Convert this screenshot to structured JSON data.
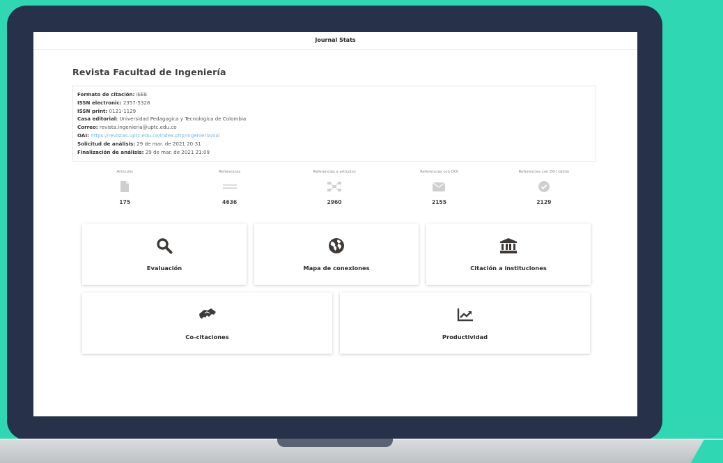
{
  "header": {
    "title": "Journal Stats"
  },
  "journal": {
    "title": "Revista Facultad de Ingeniería",
    "info": {
      "citation_format_label": "Formato de citación:",
      "citation_format": "IEEE",
      "issn_electronic_label": "ISSN electronic:",
      "issn_electronic": "2357-5328",
      "issn_print_label": "ISSN print:",
      "issn_print": "0121-1129",
      "publisher_label": "Casa editorial:",
      "publisher": "Universidad Pedagogica y Tecnologica de Colombia",
      "email_label": "Correo:",
      "email": "revista.ingenieria@uptc.edu.co",
      "oai_label": "OAI:",
      "oai": "https://revistas.uptc.edu.co/index.php/ingenieria/oai",
      "analysis_request_label": "Solicitud de análisis:",
      "analysis_request": "29 de mar. de 2021 20:31",
      "analysis_end_label": "Finalización de análisis:",
      "analysis_end": "29 de mar. de 2021 21:09"
    }
  },
  "stats": [
    {
      "label": "Articulos",
      "value": "175",
      "icon": "document-icon"
    },
    {
      "label": "Referencias",
      "value": "4636",
      "icon": "lines-icon"
    },
    {
      "label": "Referencias a articulos",
      "value": "2960",
      "icon": "network-icon"
    },
    {
      "label": "Referencias con DOI",
      "value": "2155",
      "icon": "envelope-icon"
    },
    {
      "label": "Referencias con DOI válido",
      "value": "2129",
      "icon": "check-circle-icon"
    }
  ],
  "cards": {
    "evaluation": {
      "label": "Evaluación",
      "icon": "search-icon"
    },
    "connections_map": {
      "label": "Mapa de conexiones",
      "icon": "globe-icon"
    },
    "institution_citation": {
      "label": "Citación a instituciones",
      "icon": "institution-icon"
    },
    "co_citations": {
      "label": "Co-citaciones",
      "icon": "handshake-icon"
    },
    "productivity": {
      "label": "Productividad",
      "icon": "chart-line-icon"
    }
  },
  "colors": {
    "background": "#2fd8b3",
    "bezel": "#27314a",
    "icon_dark": "#3d3a38",
    "link": "#6fb6de",
    "stat_icon": "#cfcfcf"
  }
}
